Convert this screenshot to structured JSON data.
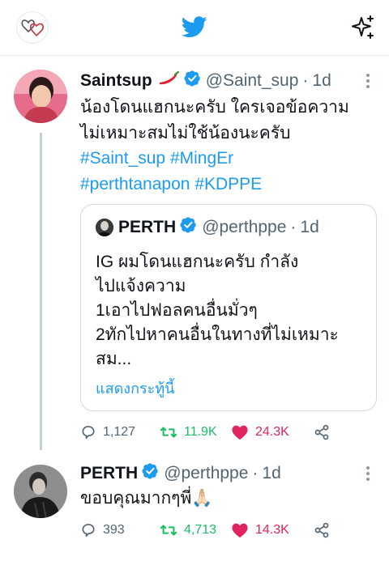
{
  "topbar": {
    "profile_icon": "hearts-logo-icon",
    "logo_icon": "twitter-bird-icon",
    "sparkle_icon": "sparkle-icon"
  },
  "tweet1": {
    "name": "Saintsup",
    "emoji": "🌶️",
    "handle": "@Saint_sup",
    "separator": "·",
    "time": "1d",
    "text_lines": [
      "น้องโดนแฮกนะครับ ใครเจอข้อความ",
      "ไม่เหมาะสมไม่ใช้น้องนะครับ"
    ],
    "hashtags_line1": [
      "#Saint_sup",
      "#MingEr"
    ],
    "hashtags_line2": [
      "#perthtanapon",
      "#KDPPE"
    ],
    "quote": {
      "name": "PERTH",
      "handle": "@perthppe",
      "separator": "·",
      "time": "1d",
      "lines": [
        "IG ผมโดนแฮกนะครับ กำลัง",
        "ไปแจ้งความ",
        "1เอาไปฟอลคนอื่นมั่วๆ",
        "2ทักไปหาคนอื่นในทางที่ไม่เหมาะ",
        "สม..."
      ],
      "show_more": "แสดงกระทู้นี้"
    },
    "stats": {
      "replies": "1,127",
      "retweets": "11.9K",
      "likes": "24.3K"
    }
  },
  "tweet2": {
    "name": "PERTH",
    "handle": "@perthppe",
    "separator": "·",
    "time": "1d",
    "text": "ขอบคุณมากๆพี่🙏🏻",
    "stats": {
      "replies": "393",
      "retweets": "4,713",
      "likes": "14.3K"
    }
  },
  "colors": {
    "accent": "#1d9bf0",
    "retweet": "#17bf63",
    "like": "#e0245e",
    "muted": "#536471"
  }
}
